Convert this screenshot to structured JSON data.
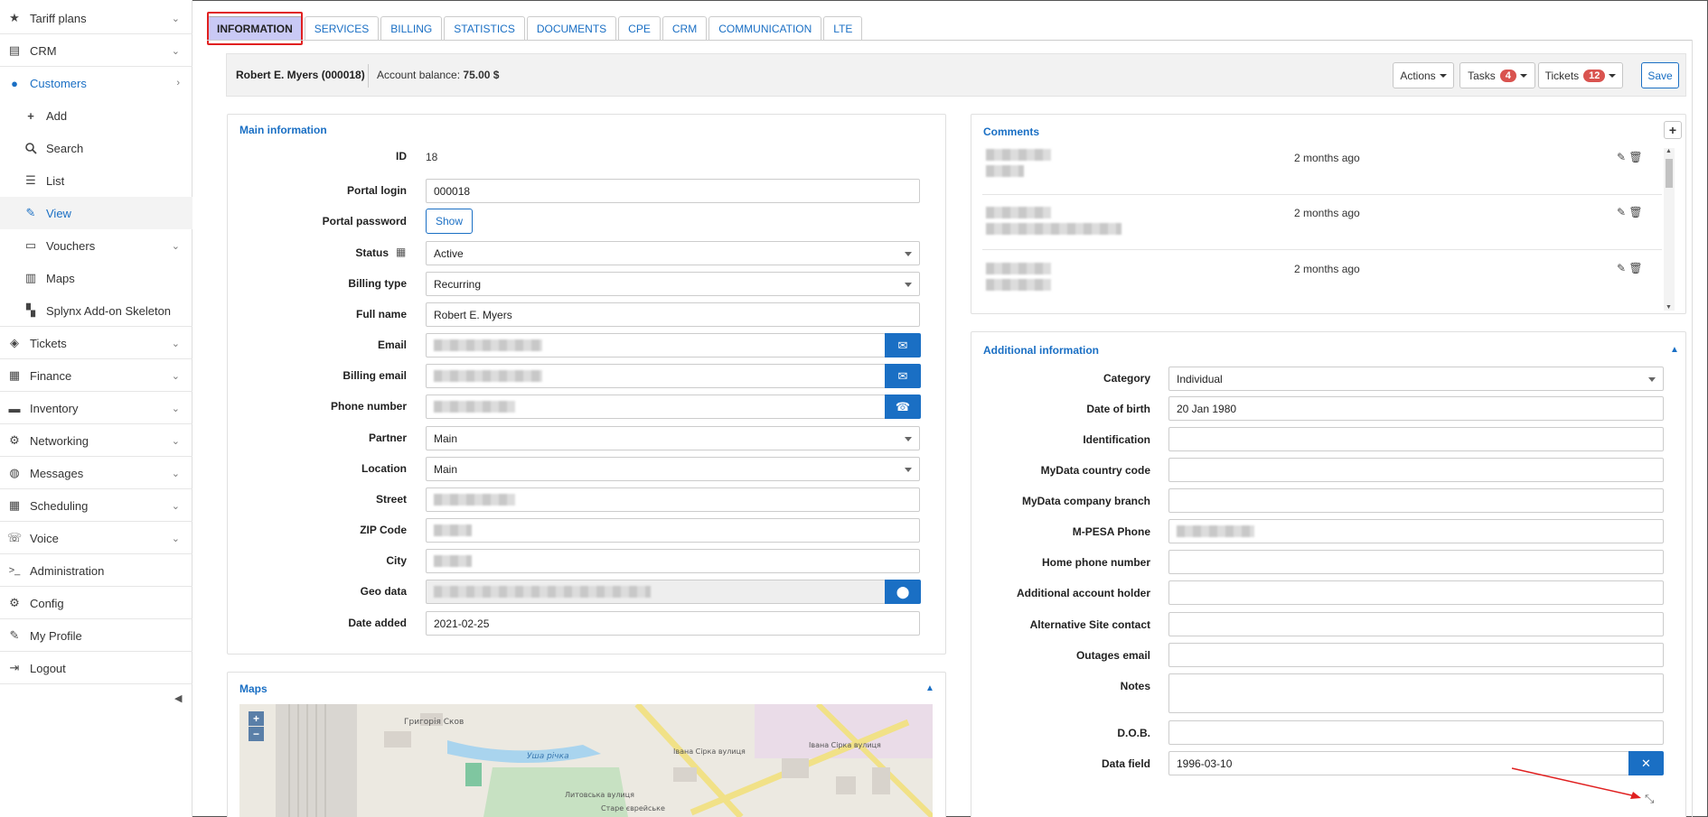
{
  "sidebar": {
    "items": [
      {
        "label": "Tariff plans",
        "icon": "star-icon",
        "chevron": "down"
      },
      {
        "label": "CRM",
        "icon": "table-icon",
        "chevron": "down"
      },
      {
        "label": "Customers",
        "icon": "user-icon",
        "chevron": "right"
      },
      {
        "label": "Add",
        "icon": "plus-icon"
      },
      {
        "label": "Search",
        "icon": "search-icon"
      },
      {
        "label": "List",
        "icon": "list-icon"
      },
      {
        "label": "View",
        "icon": "pencil-icon"
      },
      {
        "label": "Vouchers",
        "icon": "voucher-icon",
        "chevron": "down"
      },
      {
        "label": "Maps",
        "icon": "map-icon"
      },
      {
        "label": "Splynx Add-on Skeleton",
        "icon": "puzzle-icon"
      },
      {
        "label": "Tickets",
        "icon": "ticket-icon",
        "chevron": "down"
      },
      {
        "label": "Finance",
        "icon": "calculator-icon",
        "chevron": "down"
      },
      {
        "label": "Inventory",
        "icon": "folder-icon",
        "chevron": "down"
      },
      {
        "label": "Networking",
        "icon": "network-icon",
        "chevron": "down"
      },
      {
        "label": "Messages",
        "icon": "globe-icon",
        "chevron": "down"
      },
      {
        "label": "Scheduling",
        "icon": "calendar-icon",
        "chevron": "down"
      },
      {
        "label": "Voice",
        "icon": "phone-icon",
        "chevron": "down"
      },
      {
        "label": "Administration",
        "icon": "terminal-icon"
      },
      {
        "label": "Config",
        "icon": "cogs-icon"
      },
      {
        "label": "My Profile",
        "icon": "pencil-icon"
      },
      {
        "label": "Logout",
        "icon": "logout-icon"
      }
    ]
  },
  "tabs": [
    "INFORMATION",
    "SERVICES",
    "BILLING",
    "STATISTICS",
    "DOCUMENTS",
    "CPE",
    "CRM",
    "COMMUNICATION",
    "LTE"
  ],
  "header": {
    "customer_name": "Robert E. Myers (000018)",
    "balance_label": "Account balance:",
    "balance_value": "75.00 $",
    "actions_label": "Actions",
    "tasks_label": "Tasks",
    "tasks_count": "4",
    "tickets_label": "Tickets",
    "tickets_count": "12",
    "save_label": "Save"
  },
  "main_info": {
    "title": "Main information",
    "id_label": "ID",
    "id_value": "18",
    "portal_login_label": "Portal login",
    "portal_login_value": "000018",
    "portal_password_label": "Portal password",
    "show_label": "Show",
    "status_label": "Status",
    "status_value": "Active",
    "billing_type_label": "Billing type",
    "billing_type_value": "Recurring",
    "full_name_label": "Full name",
    "full_name_value": "Robert E. Myers",
    "email_label": "Email",
    "billing_email_label": "Billing email",
    "phone_label": "Phone number",
    "partner_label": "Partner",
    "partner_value": "Main",
    "location_label": "Location",
    "location_value": "Main",
    "street_label": "Street",
    "zip_label": "ZIP Code",
    "city_label": "City",
    "geo_label": "Geo data",
    "date_added_label": "Date added",
    "date_added_value": "2021-02-25"
  },
  "maps": {
    "title": "Maps",
    "zoom_in": "+",
    "zoom_out": "−"
  },
  "comments": {
    "title": "Comments",
    "items": [
      {
        "time": "2 months ago"
      },
      {
        "time": "2 months ago"
      },
      {
        "time": "2 months ago"
      }
    ]
  },
  "additional": {
    "title": "Additional information",
    "category_label": "Category",
    "category_value": "Individual",
    "dob_label": "Date of birth",
    "dob_value": "20 Jan 1980",
    "identification_label": "Identification",
    "mydata_country_label": "MyData country code",
    "mydata_branch_label": "MyData company branch",
    "mpesa_label": "M-PESA Phone",
    "home_phone_label": "Home phone number",
    "additional_holder_label": "Additional account holder",
    "alt_site_label": "Alternative Site contact",
    "outages_email_label": "Outages email",
    "notes_label": "Notes",
    "dob2_label": "D.O.B.",
    "data_field_label": "Data field",
    "data_field_value": "1996-03-10"
  },
  "colors": {
    "accent": "#1a6fc4",
    "active_tab": "#c9c9f5",
    "badge": "#d9534f",
    "highlight": "#e02020"
  }
}
